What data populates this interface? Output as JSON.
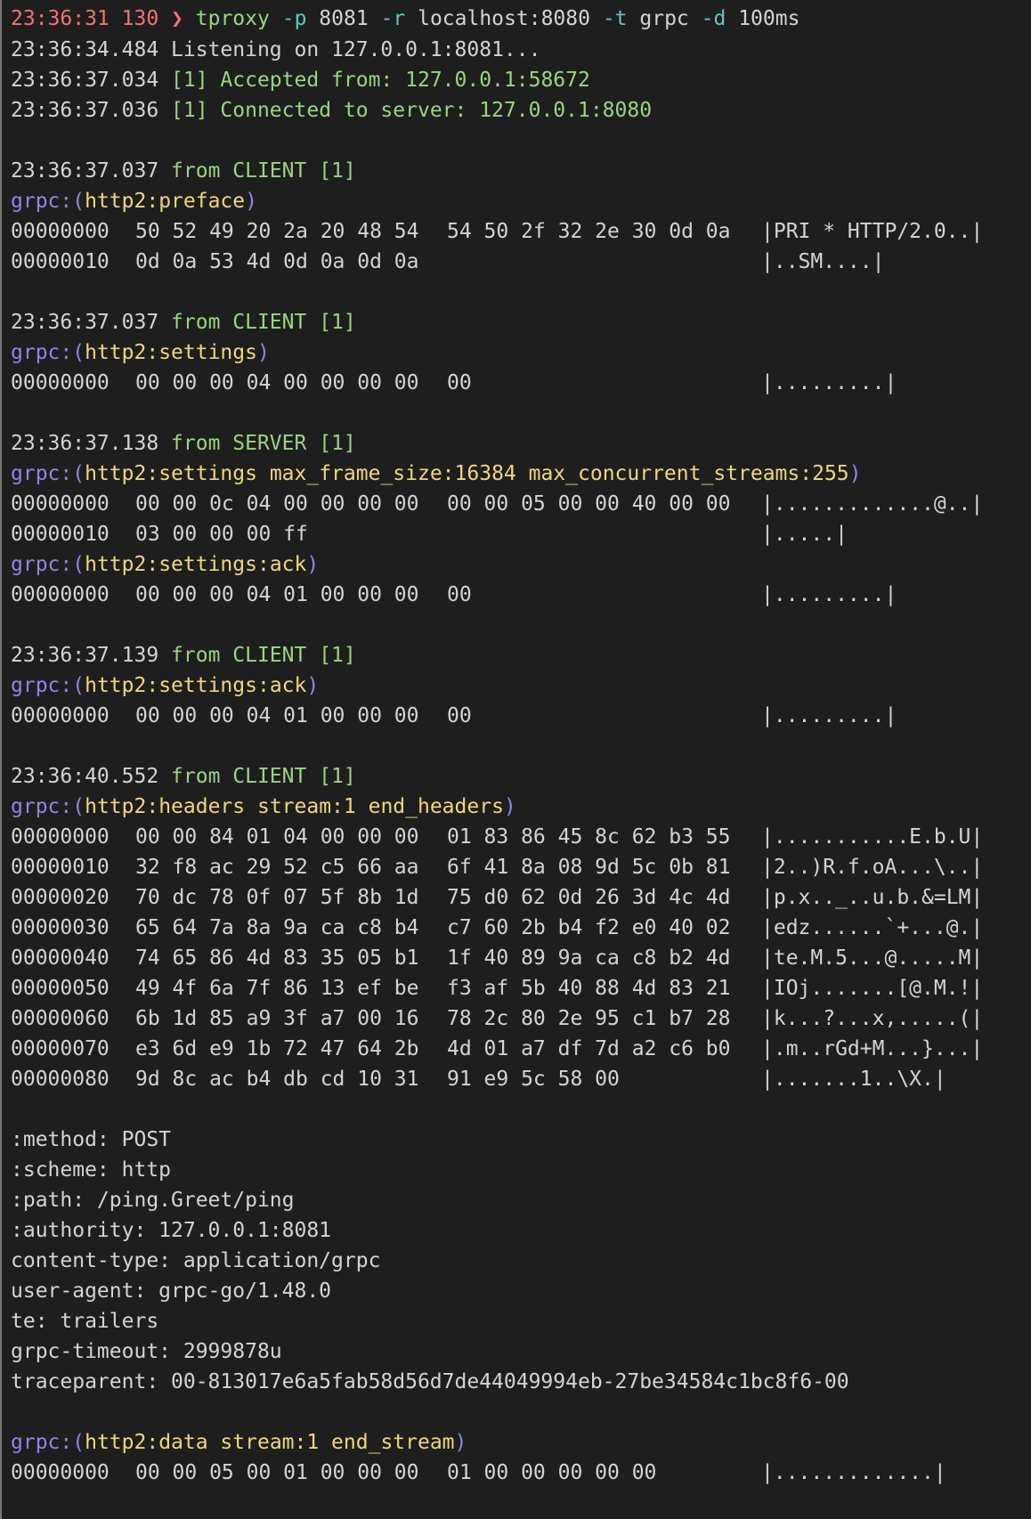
{
  "terminal": {
    "prompt": {
      "time": "23:36:31",
      "exit_code": "130",
      "arrow": "❯",
      "command": "tproxy",
      "flag_p": "-p",
      "val_p": "8081",
      "flag_r": "-r",
      "val_r": "localhost:8080",
      "flag_t": "-t",
      "val_t": "grpc",
      "flag_d": "-d",
      "val_d": "100ms"
    },
    "startup": [
      {
        "time": "23:36:34.484",
        "text": "Listening on 127.0.0.1:8081..."
      },
      {
        "time": "23:36:37.034",
        "text": "[1] Accepted from: 127.0.0.1:58672"
      },
      {
        "time": "23:36:37.036",
        "text": "[1] Connected to server: 127.0.0.1:8080"
      }
    ],
    "prefix": "grpc:",
    "blocks": [
      {
        "time": "23:36:37.037",
        "from": "from CLIENT [1]",
        "frames": [
          {
            "label": "http2:preface",
            "rows": [
              {
                "offset": "00000000",
                "g1": "50 52 49 20 2a 20 48 54",
                "g2": "54 50 2f 32 2e 30 0d 0a",
                "ascii": "|PRI * HTTP/2.0..|"
              },
              {
                "offset": "00000010",
                "g1": "0d 0a 53 4d 0d 0a 0d 0a",
                "g2": "",
                "ascii": "|..SM....|"
              }
            ]
          }
        ]
      },
      {
        "time": "23:36:37.037",
        "from": "from CLIENT [1]",
        "frames": [
          {
            "label": "http2:settings",
            "rows": [
              {
                "offset": "00000000",
                "g1": "00 00 00 04 00 00 00 00",
                "g2": "00",
                "ascii": "|.........|"
              }
            ]
          }
        ]
      },
      {
        "time": "23:36:37.138",
        "from": "from SERVER [1]",
        "frames": [
          {
            "label": "http2:settings max_frame_size:16384 max_concurrent_streams:255",
            "rows": [
              {
                "offset": "00000000",
                "g1": "00 00 0c 04 00 00 00 00",
                "g2": "00 00 05 00 00 40 00 00",
                "ascii": "|.............@..|"
              },
              {
                "offset": "00000010",
                "g1": "03 00 00 00 ff",
                "g2": "",
                "ascii": "|.....|"
              }
            ]
          },
          {
            "label": "http2:settings:ack",
            "rows": [
              {
                "offset": "00000000",
                "g1": "00 00 00 04 01 00 00 00",
                "g2": "00",
                "ascii": "|.........|"
              }
            ]
          }
        ]
      },
      {
        "time": "23:36:37.139",
        "from": "from CLIENT [1]",
        "frames": [
          {
            "label": "http2:settings:ack",
            "rows": [
              {
                "offset": "00000000",
                "g1": "00 00 00 04 01 00 00 00",
                "g2": "00",
                "ascii": "|.........|"
              }
            ]
          }
        ]
      },
      {
        "time": "23:36:40.552",
        "from": "from CLIENT [1]",
        "frames": [
          {
            "label": "http2:headers stream:1 end_headers",
            "rows": [
              {
                "offset": "00000000",
                "g1": "00 00 84 01 04 00 00 00",
                "g2": "01 83 86 45 8c 62 b3 55",
                "ascii": "|...........E.b.U|"
              },
              {
                "offset": "00000010",
                "g1": "32 f8 ac 29 52 c5 66 aa",
                "g2": "6f 41 8a 08 9d 5c 0b 81",
                "ascii": "|2..)R.f.oA...\\..|"
              },
              {
                "offset": "00000020",
                "g1": "70 dc 78 0f 07 5f 8b 1d",
                "g2": "75 d0 62 0d 26 3d 4c 4d",
                "ascii": "|p.x.._..u.b.&=LM|"
              },
              {
                "offset": "00000030",
                "g1": "65 64 7a 8a 9a ca c8 b4",
                "g2": "c7 60 2b b4 f2 e0 40 02",
                "ascii": "|edz......`+...@.|"
              },
              {
                "offset": "00000040",
                "g1": "74 65 86 4d 83 35 05 b1",
                "g2": "1f 40 89 9a ca c8 b2 4d",
                "ascii": "|te.M.5...@.....M|"
              },
              {
                "offset": "00000050",
                "g1": "49 4f 6a 7f 86 13 ef be",
                "g2": "f3 af 5b 40 88 4d 83 21",
                "ascii": "|IOj.......[@.M.!|"
              },
              {
                "offset": "00000060",
                "g1": "6b 1d 85 a9 3f a7 00 16",
                "g2": "78 2c 80 2e 95 c1 b7 28",
                "ascii": "|k...?...x,.....(|"
              },
              {
                "offset": "00000070",
                "g1": "e3 6d e9 1b 72 47 64 2b",
                "g2": "4d 01 a7 df 7d a2 c6 b0",
                "ascii": "|.m..rGd+M...}...|"
              },
              {
                "offset": "00000080",
                "g1": "9d 8c ac b4 db cd 10 31",
                "g2": "91 e9 5c 58 00",
                "ascii": "|.......1..\\X.|"
              }
            ]
          }
        ]
      }
    ],
    "headers": [
      ":method: POST",
      ":scheme: http",
      ":path: /ping.Greet/ping",
      ":authority: 127.0.0.1:8081",
      "content-type: application/grpc",
      "user-agent: grpc-go/1.48.0",
      "te: trailers",
      "grpc-timeout: 2999878u",
      "traceparent: 00-813017e6a5fab58d56d7de44049994eb-27be34584c1bc8f6-00"
    ],
    "data_frame": {
      "label": "http2:data stream:1 end_stream",
      "rows": [
        {
          "offset": "00000000",
          "g1": "00 00 05 00 01 00 00 00",
          "g2": "01 00 00 00 00 00",
          "ascii": "|.............|"
        }
      ]
    },
    "colors": {
      "background": "#1e1e1e",
      "text": "#d4d4d4",
      "green": "#98d67e",
      "red": "#f2736e",
      "cyan": "#5fc7c0",
      "purple": "#8f86e8",
      "yellow": "#f0d77a"
    }
  }
}
